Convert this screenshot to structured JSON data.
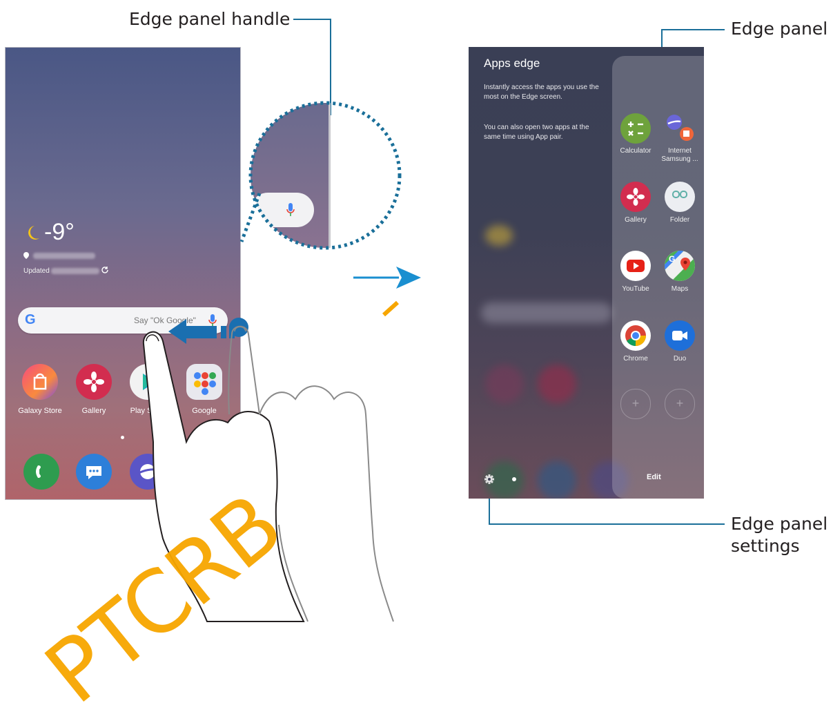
{
  "callouts": {
    "edge_panel_handle": "Edge panel handle",
    "edge_panel": "Edge panel",
    "edge_panel_settings_line1": "Edge panel",
    "edge_panel_settings_line2": "settings"
  },
  "left_screen": {
    "weather": {
      "temperature": "-9°",
      "updated_label": "Updated"
    },
    "search": {
      "placeholder": "Say \"Ok Google\""
    },
    "apps": [
      {
        "label": "Galaxy Store",
        "icon": "galaxy-store-icon"
      },
      {
        "label": "Gallery",
        "icon": "gallery-icon"
      },
      {
        "label": "Play Store",
        "icon": "play-store-icon"
      },
      {
        "label": "Google",
        "icon": "google-folder-icon"
      }
    ],
    "dock": [
      {
        "icon": "phone-icon"
      },
      {
        "icon": "messages-icon"
      },
      {
        "icon": "internet-icon"
      }
    ]
  },
  "right_screen": {
    "title": "Apps edge",
    "description1": "Instantly access the apps you use the most on the Edge screen.",
    "description2": "You can also open two apps at the same time using App pair.",
    "edit_label": "Edit",
    "panel_apps": [
      {
        "label": "Calculator",
        "icon": "calculator-icon"
      },
      {
        "label": "Internet Samsung ...",
        "icon": "samsung-internet-icon"
      },
      {
        "label": "Gallery",
        "icon": "gallery-icon"
      },
      {
        "label": "Folder",
        "icon": "folder-icon"
      },
      {
        "label": "YouTube",
        "icon": "youtube-icon"
      },
      {
        "label": "Maps",
        "icon": "maps-icon"
      },
      {
        "label": "Chrome",
        "icon": "chrome-icon"
      },
      {
        "label": "Duo",
        "icon": "duo-icon"
      }
    ]
  },
  "watermark": "PTCRB",
  "colors": {
    "callout_line": "#1a6f99",
    "arrow": "#1a8fd0",
    "watermark": "#f7a600"
  }
}
